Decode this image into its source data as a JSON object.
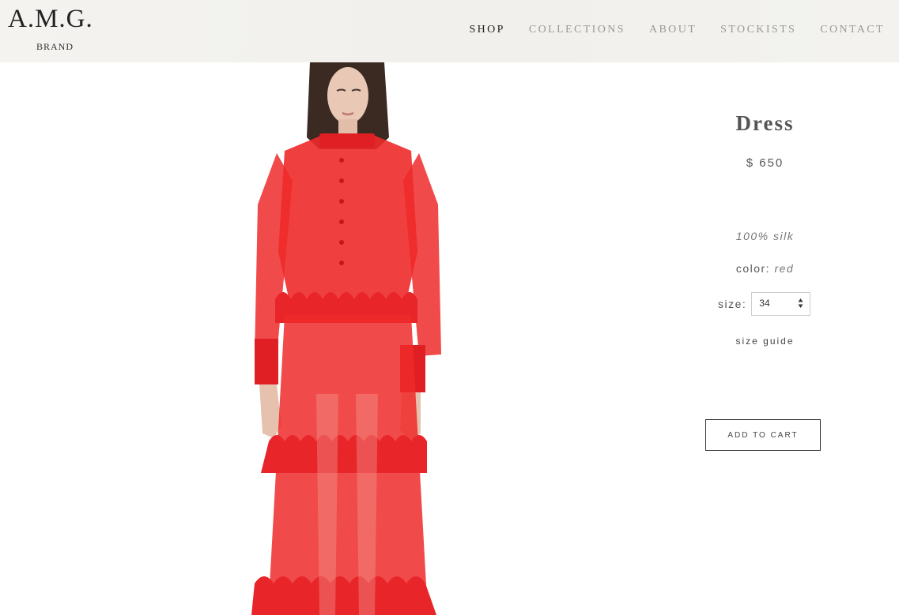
{
  "header": {
    "logo_main": "A.M.G.",
    "logo_sub": "BRAND",
    "nav": [
      {
        "label": "SHOP",
        "active": true
      },
      {
        "label": "COLLECTIONS",
        "active": false
      },
      {
        "label": "ABOUT",
        "active": false
      },
      {
        "label": "STOCKISTS",
        "active": false
      },
      {
        "label": "CONTACT",
        "active": false
      }
    ]
  },
  "product": {
    "title": "Dress",
    "price": "$ 650",
    "material": "100% silk",
    "color_label": "color:",
    "color_value": "red",
    "size_label": "size:",
    "size_value": "34",
    "size_guide": "size guide",
    "add_to_cart": "ADD TO CART",
    "dress_color": "#ee2a2a"
  }
}
